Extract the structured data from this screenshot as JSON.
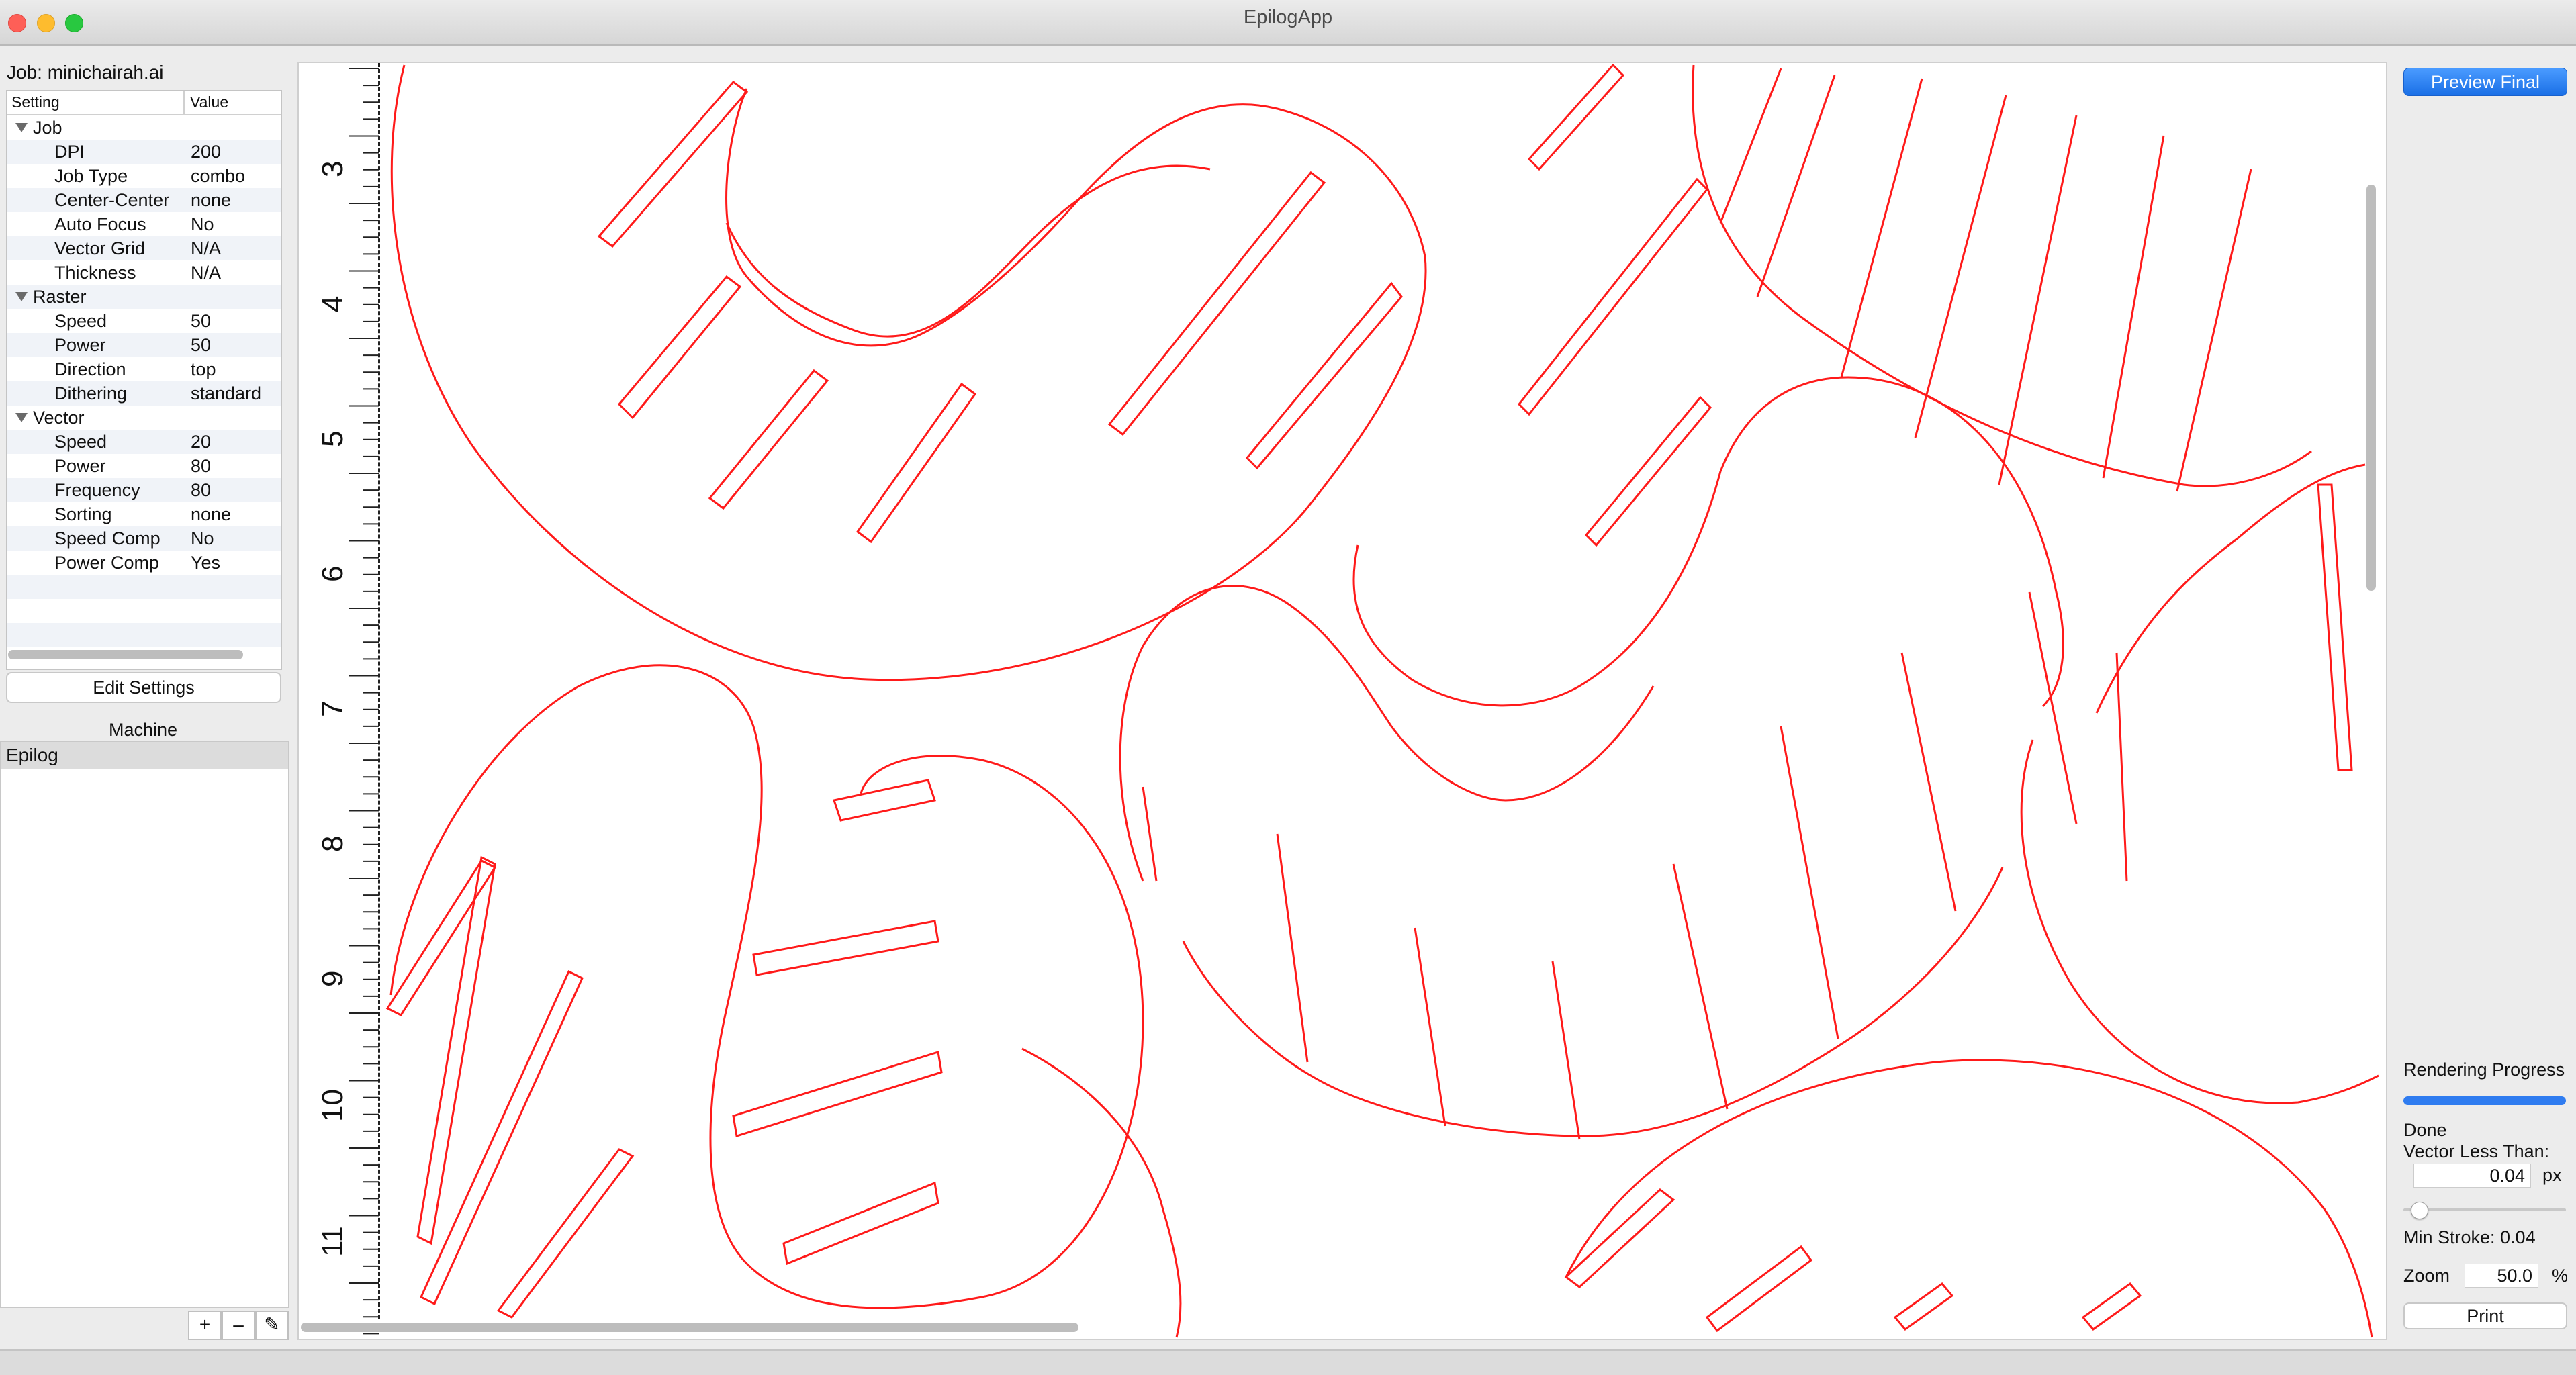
{
  "window": {
    "title": "EpilogApp"
  },
  "job": {
    "label": "Job:",
    "name": "minichairah.ai"
  },
  "settings_table": {
    "headers": [
      "Setting",
      "Value"
    ],
    "groups": [
      {
        "name": "Job",
        "items": [
          {
            "k": "DPI",
            "v": "200"
          },
          {
            "k": "Job Type",
            "v": "combo"
          },
          {
            "k": "Center-Center",
            "v": "none"
          },
          {
            "k": "Auto Focus",
            "v": "No"
          },
          {
            "k": "Vector Grid",
            "v": "N/A"
          },
          {
            "k": "Thickness",
            "v": "N/A"
          }
        ]
      },
      {
        "name": "Raster",
        "items": [
          {
            "k": "Speed",
            "v": "50"
          },
          {
            "k": "Power",
            "v": "50"
          },
          {
            "k": "Direction",
            "v": "top"
          },
          {
            "k": "Dithering",
            "v": "standard"
          }
        ]
      },
      {
        "name": "Vector",
        "items": [
          {
            "k": "Speed",
            "v": "20"
          },
          {
            "k": "Power",
            "v": "80"
          },
          {
            "k": "Frequency",
            "v": "80"
          },
          {
            "k": "Sorting",
            "v": "none"
          },
          {
            "k": "Speed Comp",
            "v": "No"
          },
          {
            "k": "Power Comp",
            "v": "Yes"
          }
        ]
      }
    ]
  },
  "buttons": {
    "edit_settings": "Edit Settings",
    "preview_final": "Preview Final",
    "print": "Print",
    "add": "+",
    "remove": "–"
  },
  "machine": {
    "header": "Machine",
    "items": [
      "Epilog"
    ]
  },
  "ruler": {
    "labels": [
      "3",
      "4",
      "5",
      "6",
      "7",
      "8",
      "9",
      "10",
      "11"
    ]
  },
  "render": {
    "progress_label": "Rendering Progress",
    "progress": 1.0,
    "status": "Done",
    "vector_less_than_label": "Vector Less Than:",
    "vector_less_than_value": "0.04",
    "vector_unit": "px",
    "min_stroke_label": "Min Stroke: 0.04",
    "zoom_label": "Zoom",
    "zoom_value": "50.0",
    "zoom_unit": "%"
  },
  "colors": {
    "cut_line": "#ff1a1a",
    "accent": "#1a6fe6"
  }
}
